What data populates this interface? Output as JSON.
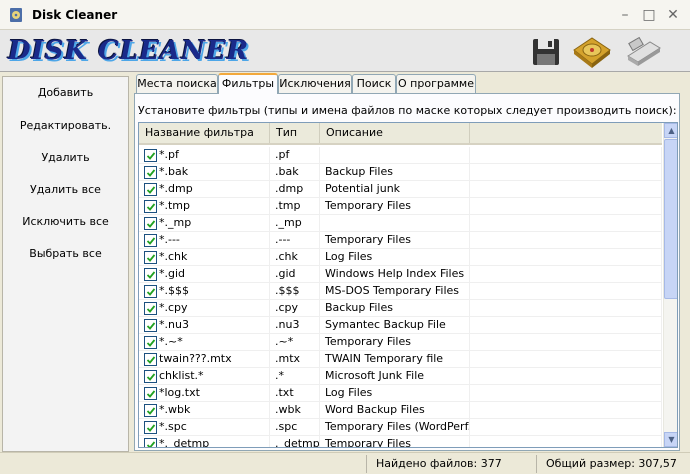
{
  "window": {
    "title": "Disk Cleaner"
  },
  "banner": {
    "logo_text": "DISK CLEANER",
    "icons": [
      "save-icon",
      "disk-icon",
      "usb-drive-icon"
    ]
  },
  "sidebar": {
    "buttons": [
      "Добавить",
      "Редактировать.",
      "Удалить",
      "Удалить все",
      "Исключить все",
      "Выбрать все"
    ]
  },
  "tabs": [
    "Места поиска",
    "Фильтры",
    "Исключения",
    "Поиск",
    "О программе"
  ],
  "active_tab": "Фильтры",
  "panel": {
    "instruction": "Установите фильтры (типы и имена файлов по маске которых следует производить поиск):"
  },
  "table": {
    "columns": [
      "Название фильтра",
      "Тип",
      "Описание"
    ],
    "rows": [
      {
        "name": "*.pf",
        "type": ".pf",
        "desc": "",
        "checked": true
      },
      {
        "name": "*.bak",
        "type": ".bak",
        "desc": "Backup Files",
        "checked": true
      },
      {
        "name": "*.dmp",
        "type": ".dmp",
        "desc": "Potential junk",
        "checked": true
      },
      {
        "name": "*.tmp",
        "type": ".tmp",
        "desc": "Temporary Files",
        "checked": true
      },
      {
        "name": "*._mp",
        "type": "._mp",
        "desc": "",
        "checked": true
      },
      {
        "name": "*.---",
        "type": ".---",
        "desc": "Temporary Files",
        "checked": true
      },
      {
        "name": "*.chk",
        "type": ".chk",
        "desc": "Log Files",
        "checked": true
      },
      {
        "name": "*.gid",
        "type": ".gid",
        "desc": "Windows Help Index Files",
        "checked": true
      },
      {
        "name": "*.$$$",
        "type": ".$$$",
        "desc": "MS-DOS Temporary Files",
        "checked": true
      },
      {
        "name": "*.cpy",
        "type": ".cpy",
        "desc": "Backup Files",
        "checked": true
      },
      {
        "name": "*.nu3",
        "type": ".nu3",
        "desc": "Symantec Backup File",
        "checked": true
      },
      {
        "name": "*.~*",
        "type": ".~*",
        "desc": "Temporary Files",
        "checked": true
      },
      {
        "name": "twain???.mtx",
        "type": ".mtx",
        "desc": "TWAIN Temporary file",
        "checked": true
      },
      {
        "name": "chklist.*",
        "type": ".*",
        "desc": "Microsoft Junk File",
        "checked": true
      },
      {
        "name": "*log.txt",
        "type": ".txt",
        "desc": "Log Files",
        "checked": true
      },
      {
        "name": "*.wbk",
        "type": ".wbk",
        "desc": "Word Backup Files",
        "checked": true
      },
      {
        "name": "*.spc",
        "type": ".spc",
        "desc": "Temporary Files (WordPerf...",
        "checked": true
      },
      {
        "name": "*._detmp",
        "type": "._detmp",
        "desc": "Temporary Files",
        "checked": true
      }
    ]
  },
  "statusbar": {
    "files_found": "Найдено файлов: 377",
    "total_size": "Общий размер: 307,57"
  }
}
